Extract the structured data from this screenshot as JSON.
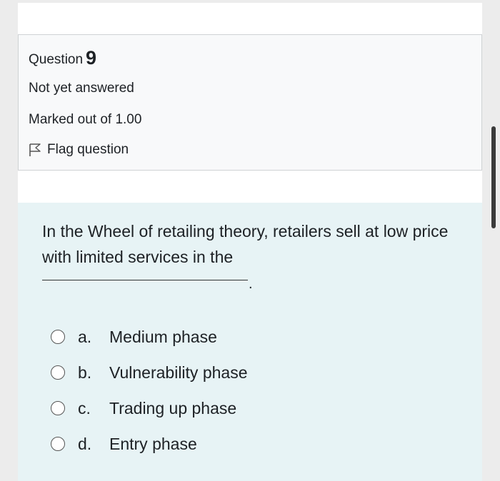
{
  "question_info": {
    "label": "Question",
    "number": "9",
    "state": "Not yet answered",
    "grade": "Marked out of 1.00",
    "flag_label": "Flag question"
  },
  "question": {
    "text": "In the Wheel of retailing theory, retailers sell at low price with limited services in the",
    "blank_end": "."
  },
  "answers": [
    {
      "letter": "a.",
      "text": "Medium phase",
      "selected": false
    },
    {
      "letter": "b.",
      "text": "Vulnerability phase",
      "selected": false
    },
    {
      "letter": "c.",
      "text": "Trading up phase",
      "selected": false
    },
    {
      "letter": "d.",
      "text": "Entry phase",
      "selected": false
    }
  ],
  "colors": {
    "info_bg": "#f8f9fa",
    "formulation_bg": "#e7f3f5",
    "text": "#1d2125"
  }
}
